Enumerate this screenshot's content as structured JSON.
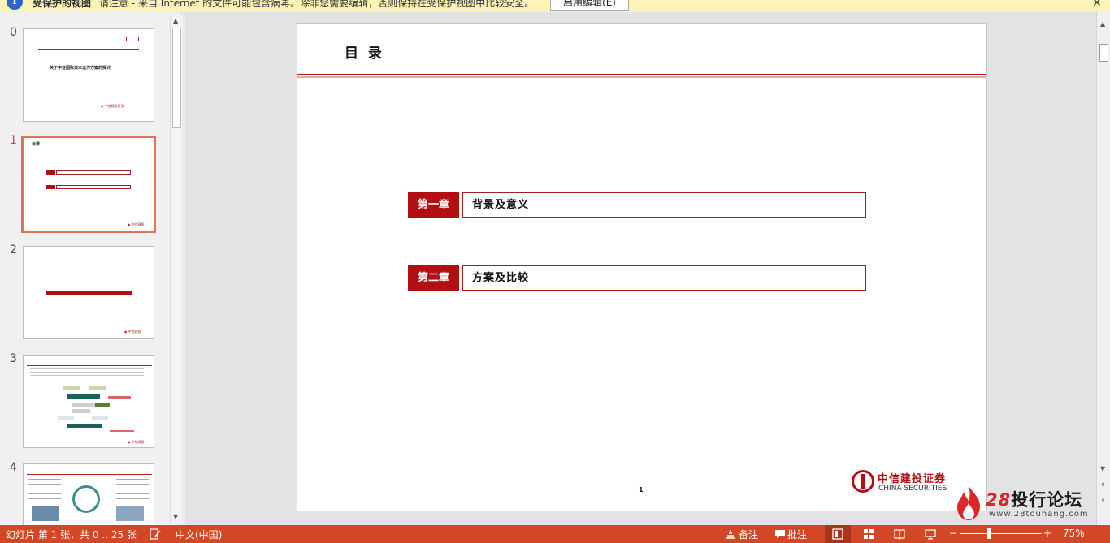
{
  "protected_view": {
    "title": "受保护的视图",
    "message": "请注意 - 来自 Internet 的文件可能包含病毒。除非您需要编辑，否则保持在受保护视图中比较安全。",
    "enable_button": "启用编辑(E)",
    "close_glyph": "✕"
  },
  "thumbnails": [
    {
      "number": "0",
      "title": "关于中亚国际资本运作方案的探讨",
      "tag": "目录",
      "active": false
    },
    {
      "number": "1",
      "title": "目录",
      "active": true
    },
    {
      "number": "2",
      "active": false
    },
    {
      "number": "3",
      "active": false
    },
    {
      "number": "4",
      "active": false
    }
  ],
  "slide": {
    "title": "目 录",
    "chapters": [
      {
        "tag": "第一章",
        "label": "背景及意义"
      },
      {
        "tag": "第二章",
        "label": "方案及比较"
      }
    ],
    "page_number": "1",
    "logo_cn": "中信建投证券",
    "logo_en": "CHINA SECURITIES"
  },
  "watermark": {
    "number": "28",
    "text": "投行论坛",
    "url": "www.28touhang.com"
  },
  "status_bar": {
    "slide_info": "幻灯片 第 1 张，共 0 .. 25 张",
    "language": "中文(中国)",
    "notes": "备注",
    "comments": "批注",
    "zoom_minus": "−",
    "zoom_plus": "+",
    "zoom_level": "75%"
  },
  "colors": {
    "accent": "#d24726",
    "slide_red": "#b10f11",
    "protected_bar": "#fcf3b7"
  }
}
